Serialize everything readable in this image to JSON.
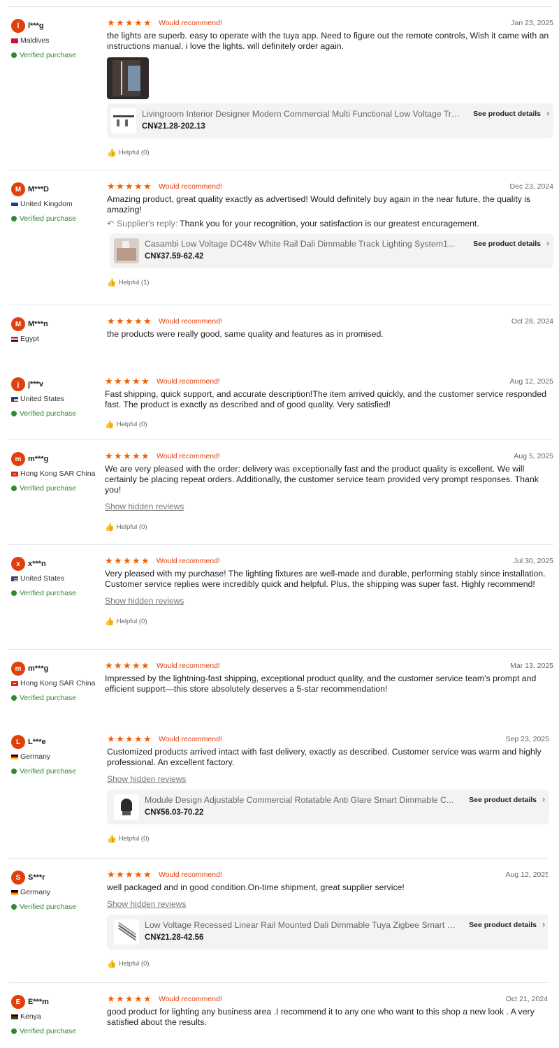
{
  "labels": {
    "recommend": "Would recommend!",
    "verified": "Verified purchase",
    "see_details": "See product details",
    "show_hidden": "Show hidden reviews",
    "supplier_reply": "Supplier's reply:"
  },
  "colors": {
    "accent": "#e0400d",
    "stars": "#f06000",
    "verified": "#2e8b2e"
  },
  "rating_stars": 5,
  "reviews": [
    {
      "initial": "l",
      "user": "l***g",
      "country": "Maldives",
      "date": "Jan 23, 2025",
      "text": "the lights are superb. easy to operate with the tuya app. Need to figure out the remote controls, Wish it came with an instructions manual. i love the lights. will definitely order again.",
      "product_title": "Livingroom Interior Designer Modern Commercial Multi Functional Low Voltage Track Lighting",
      "product_price": "CN¥21.28-202.13",
      "helpful": "Helpful (0)"
    },
    {
      "initial": "M",
      "user": "M***D",
      "country": "United Kingdom",
      "date": "Dec 23, 2024",
      "text": "Amazing product, great quality exactly as advertised! Would definitely buy again in the near future, the quality is amazing!",
      "reply": "Thank you for your recognition, your satisfaction is our greatest encuragement.",
      "product_title": "Casambi Low Voltage DC48v White Rail Dali Dimmable Track Lighting System1...",
      "product_price": "CN¥37.59-62.42",
      "helpful": "Helpful (1)"
    },
    {
      "initial": "M",
      "user": "M***n",
      "country": "Egypt",
      "date": "Oct 28, 2024",
      "text": "the products were really good, same quality and features as in promised."
    },
    {
      "initial": "j",
      "user": "j***v",
      "country": "United States",
      "date": "Aug 12, 2025",
      "text": "Fast shipping, quick support, and accurate description!The item arrived quickly, and the customer service responded fast. The product is exactly as described and of good quality. Very satisfied!",
      "helpful": "Helpful (0)"
    },
    {
      "initial": "m",
      "user": "m***g",
      "country": "Hong Kong SAR China",
      "date": "Aug 5, 2025",
      "text": "We are very pleased with the order: delivery was exceptionally fast and the product quality is excellent. We will certainly be placing repeat orders. Additionally, the customer service team provided very prompt responses. Thank you!",
      "helpful": "Helpful (0)"
    },
    {
      "initial": "x",
      "user": "x***n",
      "country": "United States",
      "date": "Jul 30, 2025",
      "text": "Very pleased with my purchase! The lighting fixtures are well-made and durable, performing stably since installation. Customer service replies were incredibly quick and helpful. Plus, the shipping was super fast. Highly recommend!",
      "helpful": "Helpful (0)"
    },
    {
      "initial": "m",
      "user": "m***g",
      "country": "Hong Kong SAR China",
      "date": "Mar 13, 2025",
      "text": "Impressed by the lightning-fast shipping, exceptional product quality, and the customer service team's prompt and efficient support—this store absolutely deserves a 5-star recommendation!"
    },
    {
      "initial": "L",
      "user": "L***e",
      "country": "Germany",
      "date": "Sep 23, 2025",
      "text": "Customized products arrived intact with fast delivery, exactly as described. Customer service was warm and highly professional. An excellent factory.",
      "product_title": "Module Design Adjustable Commercial Rotatable Anti Glare Smart Dimmable C...",
      "product_price": "CN¥56.03-70.22",
      "helpful": "Helpful (0)"
    },
    {
      "initial": "S",
      "user": "S***r",
      "country": "Germany",
      "date": "Aug 12, 2025",
      "text": "well packaged and in good condition.On-time shipment,  great supplier service!",
      "product_title": "Low Voltage Recessed Linear Rail Mounted Dali Dimmable Tuya Zigbee Smart S...",
      "product_price": "CN¥21.28-42.56",
      "helpful": "Helpful (0)"
    },
    {
      "initial": "E",
      "user": "E***m",
      "country": "Kenya",
      "date": "Oct 21, 2024",
      "text": "good product for lighting any business area .I recommend it to any one who want to this shop a new look . A very satisfied about the results."
    }
  ]
}
